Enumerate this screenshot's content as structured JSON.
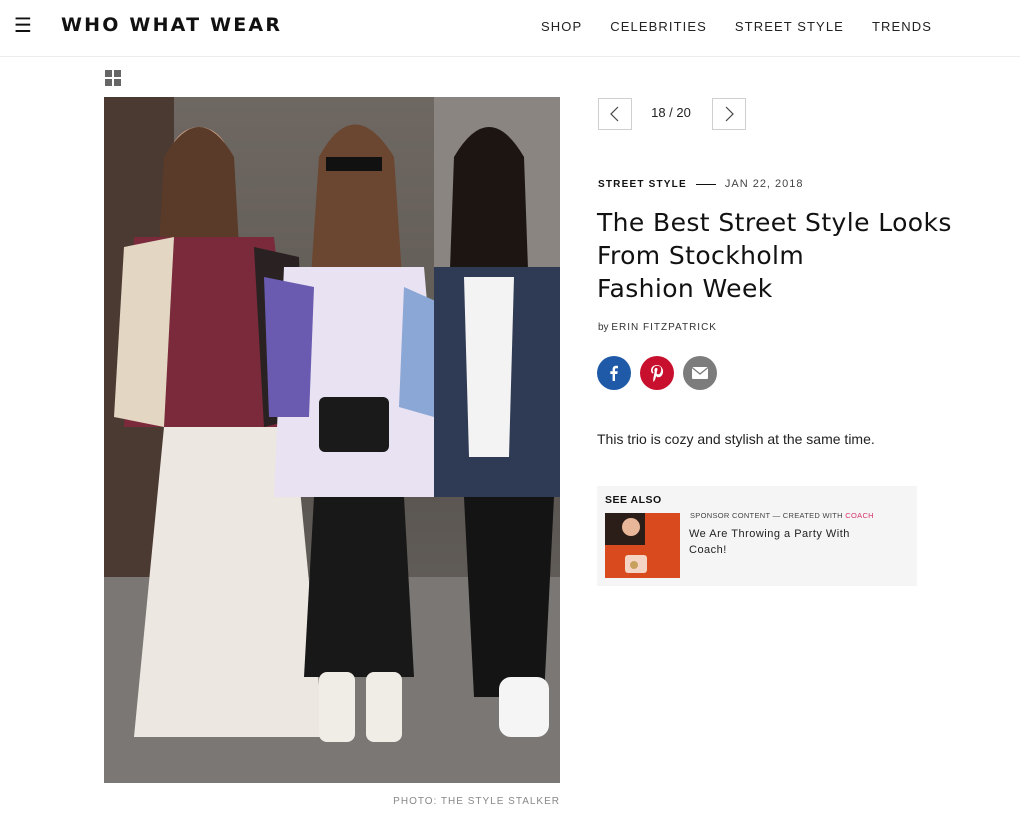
{
  "header": {
    "menu_icon": "hamburger-menu-icon",
    "logo": "WHO WHAT WEAR",
    "nav": [
      "SHOP",
      "CELEBRITIES",
      "STREET STYLE",
      "TRENDS"
    ]
  },
  "gallery": {
    "grid_icon": "grid-view-icon",
    "photo_credit": "PHOTO: THE STYLE STALKER",
    "prev_icon": "chevron-left-icon",
    "next_icon": "chevron-right-icon",
    "counter": "18 / 20"
  },
  "article": {
    "category": "STREET STYLE",
    "date": "JAN 22, 2018",
    "headline_lines": [
      "The Best Street Style Looks",
      "From Stockholm",
      "Fashion Week"
    ],
    "byline_prefix": "by",
    "author": "ERIN FITZPATRICK",
    "caption": "This trio is cozy and stylish at the same time."
  },
  "share": {
    "facebook_icon": "facebook-icon",
    "pinterest_icon": "pinterest-icon",
    "email_icon": "email-icon"
  },
  "see_also": {
    "label": "SEE ALSO",
    "sponsor_prefix": "SPONSOR CONTENT — CREATED WITH",
    "sponsor_brand": "COACH",
    "title": "We Are Throwing a Party With Coach!"
  },
  "colors": {
    "facebook": "#1f5aa8",
    "pinterest": "#c8102e",
    "email": "#7c7c7c",
    "sponsor_brand": "#d6336c"
  }
}
